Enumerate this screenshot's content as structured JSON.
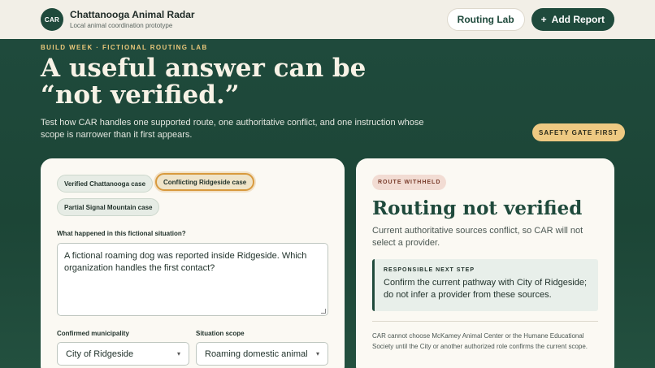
{
  "app": {
    "logo_text": "CAR",
    "title": "Chattanooga Animal Radar",
    "subtitle": "Local animal coordination prototype"
  },
  "nav": {
    "routing_lab": "Routing Lab",
    "add_icon": "+",
    "add_report": "Add Report"
  },
  "hero": {
    "eyebrow": "BUILD WEEK · FICTIONAL ROUTING LAB",
    "headline": "A useful answer can be “not verified.”",
    "intro": "Test how CAR handles one supported route, one authoritative conflict, and one instruction whose scope is narrower than it first appears.",
    "badge": "SAFETY GATE FIRST"
  },
  "cases": {
    "items": [
      {
        "label": "Verified Chattanooga case",
        "active": false
      },
      {
        "label": "Conflicting Ridgeside case",
        "active": true
      },
      {
        "label": "Partial Signal Mountain case",
        "active": false
      }
    ]
  },
  "form": {
    "situation_label": "What happened in this fictional situation?",
    "situation_value": "A fictional roaming dog was reported inside Ridgeside. Which organization handles the first contact?",
    "municipality_label": "Confirmed municipality",
    "municipality_value": "City of Ridgeside",
    "scope_label": "Situation scope",
    "scope_value": "Roaming domestic animal",
    "select_icon": "chevron-down-icon"
  },
  "result": {
    "badge": "ROUTE WITHHELD",
    "title": "Routing not verified",
    "body": "Current authoritative sources conflict, so CAR will not select a provider.",
    "next_label": "RESPONSIBLE NEXT STEP",
    "next_text": "Confirm the current pathway with City of Ridgeside; do not infer a provider from these sources.",
    "note": "CAR cannot choose McKamey Animal Center or the Humane Educational Society until the City or another authorized role confirms the current scope."
  },
  "colors": {
    "brand_green": "#1f4a3c",
    "accent_gold": "#eec982",
    "active_chip_border": "#d89a3e",
    "withheld_badge": "#f2dcd3"
  }
}
